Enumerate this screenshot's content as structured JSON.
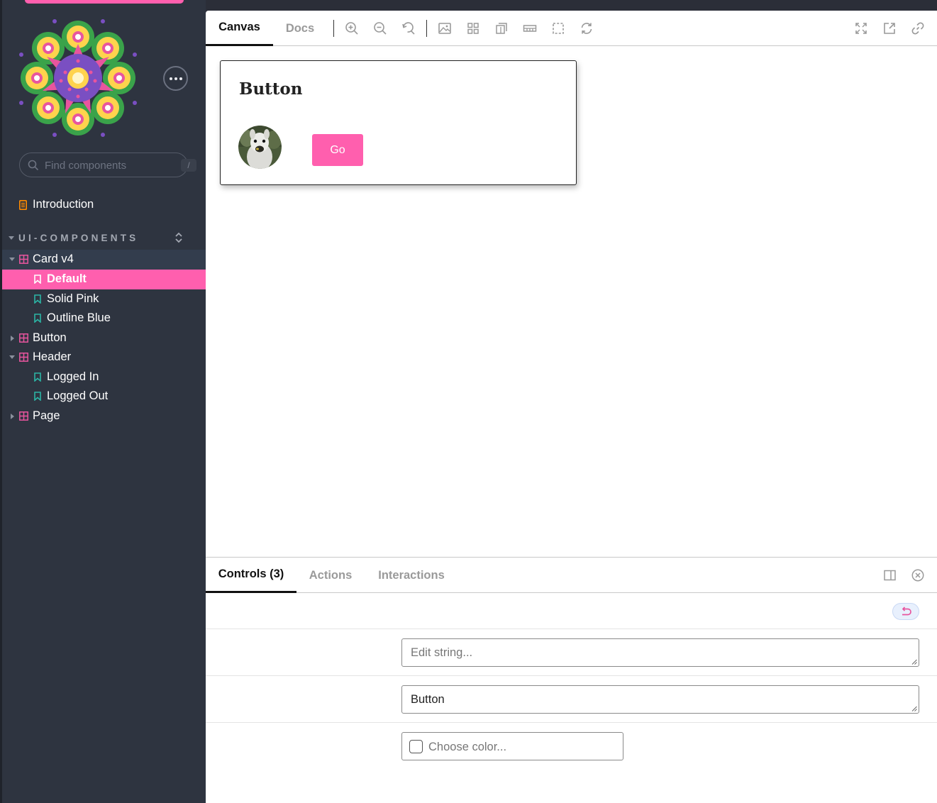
{
  "sidebar": {
    "search": {
      "placeholder": "Find components",
      "shortcut": "/"
    },
    "introduction_label": "Introduction",
    "section_label": "UI-COMPONENTS",
    "items": [
      {
        "label": "Card v4",
        "kind": "component",
        "expanded": true
      },
      {
        "label": "Default",
        "kind": "story",
        "selected": true
      },
      {
        "label": "Solid Pink",
        "kind": "story"
      },
      {
        "label": "Outline Blue",
        "kind": "story"
      },
      {
        "label": "Button",
        "kind": "component",
        "expanded": false
      },
      {
        "label": "Header",
        "kind": "component",
        "expanded": true
      },
      {
        "label": "Logged In",
        "kind": "story"
      },
      {
        "label": "Logged Out",
        "kind": "story"
      },
      {
        "label": "Page",
        "kind": "component",
        "expanded": false
      }
    ]
  },
  "toolbar": {
    "tabs": [
      {
        "label": "Canvas"
      },
      {
        "label": "Docs"
      }
    ],
    "icons": [
      "zoom-in-icon",
      "zoom-out-icon",
      "zoom-reset-icon",
      "background-icon",
      "grid-icon",
      "viewport-icon",
      "measure-icon",
      "outline-icon",
      "remount-icon",
      "fullscreen-icon",
      "open-new-tab-icon",
      "copy-link-icon"
    ]
  },
  "preview": {
    "card_title": "Button",
    "button_label": "Go"
  },
  "addons": {
    "tabs": [
      {
        "label": "Controls (3)"
      },
      {
        "label": "Actions"
      },
      {
        "label": "Interactions"
      }
    ],
    "controls": {
      "field1": {
        "placeholder": "Edit string...",
        "value": ""
      },
      "field2": {
        "value": "Button"
      },
      "color": {
        "placeholder": "Choose color..."
      }
    }
  },
  "colors": {
    "accent": "#ff5fae",
    "sidebar_bg": "#2e3440",
    "story_icon": "#2bb5a5",
    "component_icon": "#e8559e",
    "doc_icon": "#ff8a00"
  }
}
